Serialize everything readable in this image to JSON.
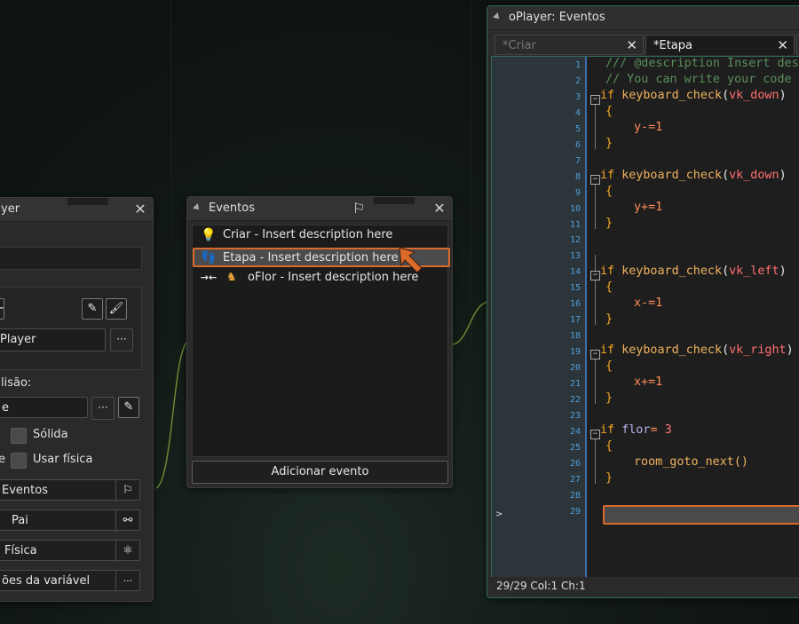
{
  "object_window": {
    "title": "yer",
    "sprite_name": "Player",
    "collision_label": "lisão:",
    "collision_value": "e",
    "solid_label": "Sólida",
    "physics_prefix": "e",
    "physics_label": "Usar física",
    "buttons": [
      "Eventos",
      "Pai",
      "Física",
      "ões da variável"
    ],
    "dots": "···"
  },
  "events_window": {
    "title": "Eventos",
    "items": [
      {
        "icon": "lightbulb-icon",
        "label": "Criar - Insert description here"
      },
      {
        "icon": "footsteps-icon",
        "label": "Etapa - Insert description here"
      },
      {
        "icon": "collision-arrows-icon",
        "label": "oFlor - Insert description here"
      }
    ],
    "add_button": "Adicionar evento"
  },
  "code_window": {
    "title": "oPlayer: Eventos",
    "tabs": [
      {
        "label": "*Criar",
        "active": false
      },
      {
        "label": "*Etapa",
        "active": true
      }
    ],
    "status": "29/29 Col:1 Ch:1",
    "line_numbers": [
      "1",
      "2",
      "3",
      "4",
      "5",
      "6",
      "7",
      "8",
      "9",
      "10",
      "11",
      "12",
      "13",
      "14",
      "15",
      "16",
      "17",
      "18",
      "19",
      "20",
      "21",
      "22",
      "23",
      "24",
      "25",
      "26",
      "27",
      "28",
      "29"
    ],
    "lines": {
      "l1": "/// @description Insert desc",
      "l2": "// You can write your code i",
      "l3_kw": "if",
      "l3_fn": "keyboard_check",
      "l3_arg": "vk_down",
      "l5": "y-=1",
      "l8_kw": "if",
      "l8_fn": "keyboard_check",
      "l8_arg": "vk_down",
      "l10": "y+=1",
      "l14_kw": "if",
      "l14_fn": "keyboard_check",
      "l14_arg": "vk_left",
      "l16": "x-=1",
      "l19_kw": "if",
      "l19_fn": "keyboard_check",
      "l19_arg": "vk_right",
      "l21": "x+=1",
      "l24_kw": "if",
      "l24_var": "flor",
      "l24_op": "= ",
      "l24_num": "3",
      "l26": "room_goto_next()",
      "open_brace": "{",
      "close_brace": "}"
    }
  },
  "colors": {
    "accent": "#d96a2b",
    "wire": "#7fa43a",
    "line_numbers": "#4f9fdd"
  }
}
